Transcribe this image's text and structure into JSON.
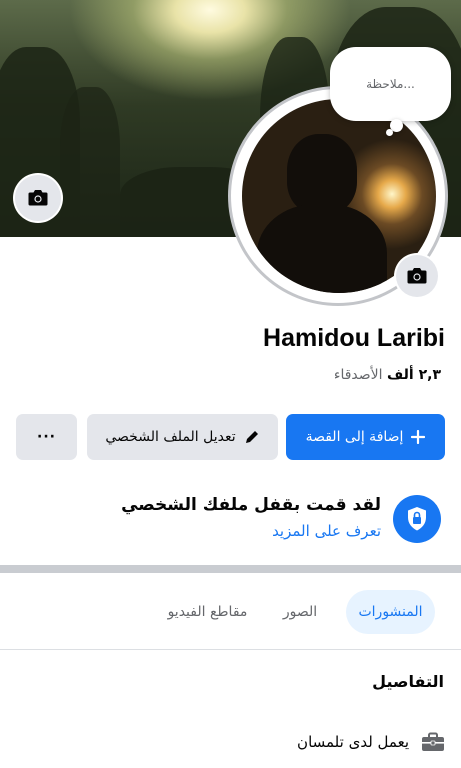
{
  "cover": {
    "camera_icon": "camera-icon"
  },
  "profile": {
    "note_placeholder": "ملاحظة...",
    "name": "Hamidou Laribi",
    "friends_count": "٢,٣ ألف",
    "friends_label": "الأصدقاء",
    "camera_icon": "camera-icon"
  },
  "actions": {
    "add_story": "إضافة إلى القصة",
    "edit_profile": "تعديل الملف الشخصي",
    "more": "···"
  },
  "lock_notice": {
    "title": "لقد قمت بقفل ملفك الشخصي",
    "link": "تعرف على المزيد"
  },
  "tabs": [
    {
      "label": "المنشورات",
      "active": true
    },
    {
      "label": "الصور",
      "active": false
    },
    {
      "label": "مقاطع الفيديو",
      "active": false
    }
  ],
  "details": {
    "title": "التفاصيل",
    "work": "يعمل لدى تلمسان"
  },
  "colors": {
    "accent": "#1877f2",
    "secondary_button": "#e4e6eb",
    "muted_text": "#65676b"
  }
}
